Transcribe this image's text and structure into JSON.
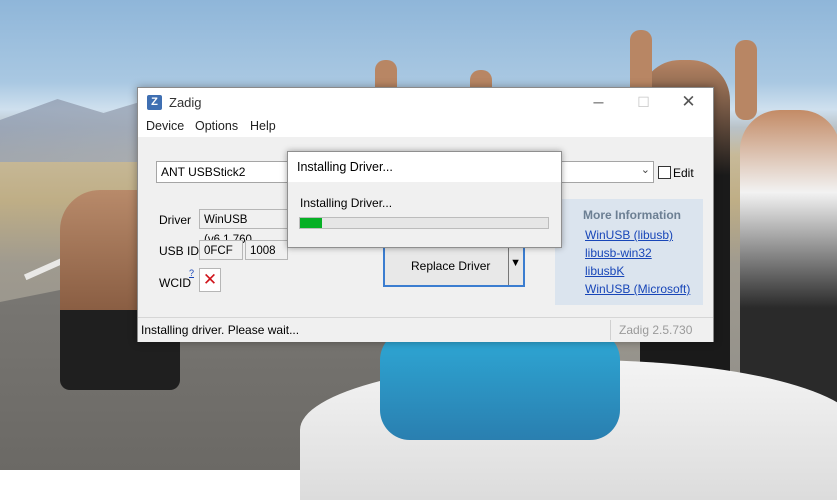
{
  "window": {
    "title": "Zadig",
    "app_icon_letter": "Z",
    "controls": {
      "minimize": "─",
      "maximize": "☐",
      "close": "✕"
    }
  },
  "menu": [
    "Device",
    "Options",
    "Help"
  ],
  "device": {
    "selected": "ANT USBStick2",
    "dropdown_arrow": "⌄",
    "edit_label": "Edit"
  },
  "driver": {
    "label": "Driver",
    "value": "WinUSB (v6.1.760",
    "usb_id_label": "USB ID",
    "usb_id_vendor": "0FCF",
    "usb_id_product": "1008",
    "wcid_label": "WCID",
    "wcid_superscript": "?",
    "wcid_status": "✕"
  },
  "replace_button": {
    "label": "Replace Driver",
    "dropdown_arrow": "▼"
  },
  "more_info": {
    "title": "More Information",
    "links": [
      "WinUSB (libusb)",
      "libusb-win32",
      "libusbK",
      "WinUSB (Microsoft)"
    ]
  },
  "status": {
    "text": "Installing driver. Please wait...",
    "version": "Zadig 2.5.730"
  },
  "dialog": {
    "title": "Installing Driver...",
    "message": "Installing Driver...",
    "progress_fraction": 0.09,
    "progress_color": "#06b025"
  }
}
